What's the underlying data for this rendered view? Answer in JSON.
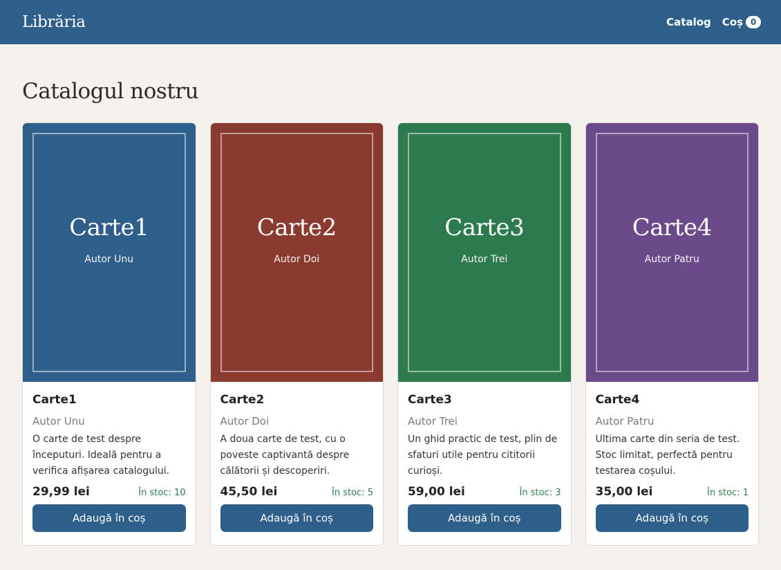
{
  "header": {
    "brand": "Librăria",
    "nav": {
      "catalog": "Catalog",
      "cart": "Coș",
      "cart_count": "0"
    }
  },
  "main": {
    "title": "Catalogul nostru",
    "books": [
      {
        "title": "Carte1",
        "author": "Autor Unu",
        "description": "O carte de test despre începuturi. Ideală pentru a verifica afișarea catalogului.",
        "price": "29,99 lei",
        "stock": "În stoc: 10",
        "button": "Adaugă în coș",
        "cover_color": "#2e5f8a"
      },
      {
        "title": "Carte2",
        "author": "Autor Doi",
        "description": "A doua carte de test, cu o poveste captivantă despre călătorii și descoperiri.",
        "price": "45,50 lei",
        "stock": "În stoc: 5",
        "button": "Adaugă în coș",
        "cover_color": "#8b3a2f"
      },
      {
        "title": "Carte3",
        "author": "Autor Trei",
        "description": "Un ghid practic de test, plin de sfaturi utile pentru cititorii curioși.",
        "price": "59,00 lei",
        "stock": "În stoc: 3",
        "button": "Adaugă în coș",
        "cover_color": "#2e7a4f"
      },
      {
        "title": "Carte4",
        "author": "Autor Patru",
        "description": "Ultima carte din seria de test. Stoc limitat, perfectă pentru testarea coșului.",
        "price": "35,00 lei",
        "stock": "În stoc: 1",
        "button": "Adaugă în coș",
        "cover_color": "#6b4a8a"
      }
    ]
  }
}
